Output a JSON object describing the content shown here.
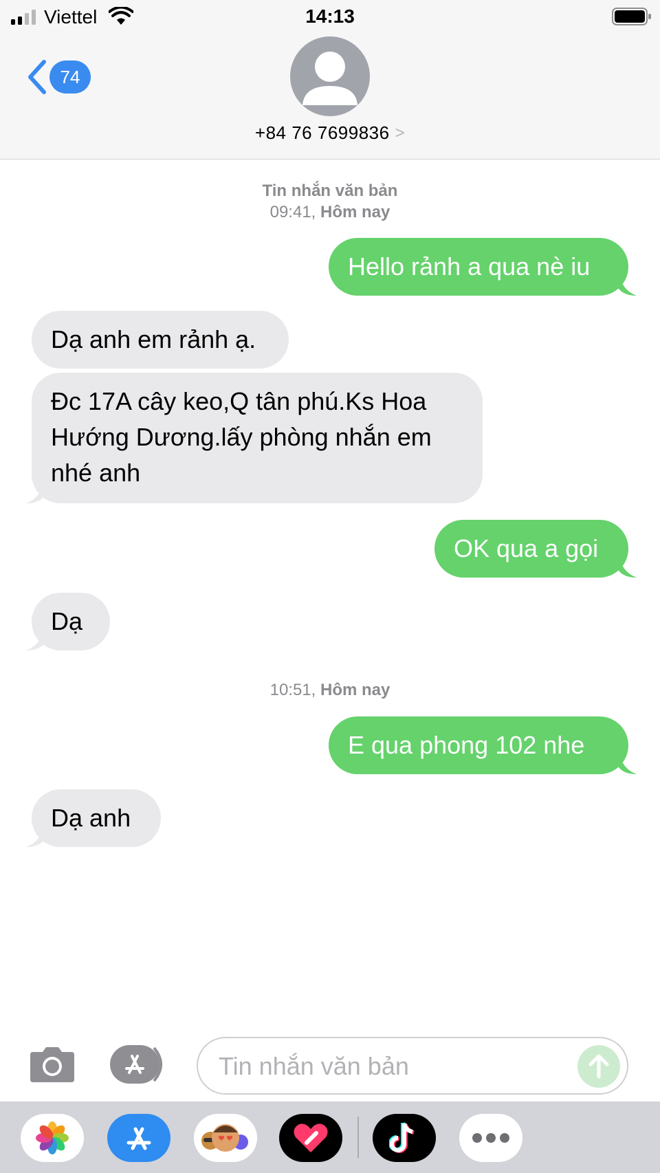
{
  "status_bar": {
    "carrier": "Viettel",
    "time": "14:13"
  },
  "nav": {
    "back_badge": "74",
    "contact": "+84 76 7699836",
    "chevron": ">"
  },
  "conversation": {
    "header_1": {
      "type": "Tin nhắn văn bản",
      "time": "09:41,",
      "day": "Hôm nay"
    },
    "header_2": {
      "time": "10:51,",
      "day": "Hôm nay"
    },
    "messages": [
      {
        "from": "me",
        "text": "Hello rảnh a qua nè iu"
      },
      {
        "from": "them",
        "text": "Dạ anh em rảnh ạ."
      },
      {
        "from": "them",
        "text": "Đc 17A cây keo,Q tân phú.Ks Hoa Hướng Dương.lấy phòng nhắn em nhé anh"
      },
      {
        "from": "me",
        "text": "OK qua a gọi"
      },
      {
        "from": "them",
        "text": "Dạ"
      },
      {
        "from": "me",
        "text": "E qua  phong 102 nhe"
      },
      {
        "from": "them",
        "text": "Dạ anh"
      }
    ]
  },
  "input": {
    "placeholder": "Tin nhắn văn bản"
  },
  "drawer": {
    "apps": [
      "photos-icon",
      "app-store-icon",
      "memoji-icon",
      "digital-touch-icon",
      "tiktok-icon",
      "more-icon"
    ]
  },
  "colors": {
    "sent_bubble": "#65d26c",
    "received_bubble": "#e9e9eb",
    "accent": "#3a8bf0"
  }
}
